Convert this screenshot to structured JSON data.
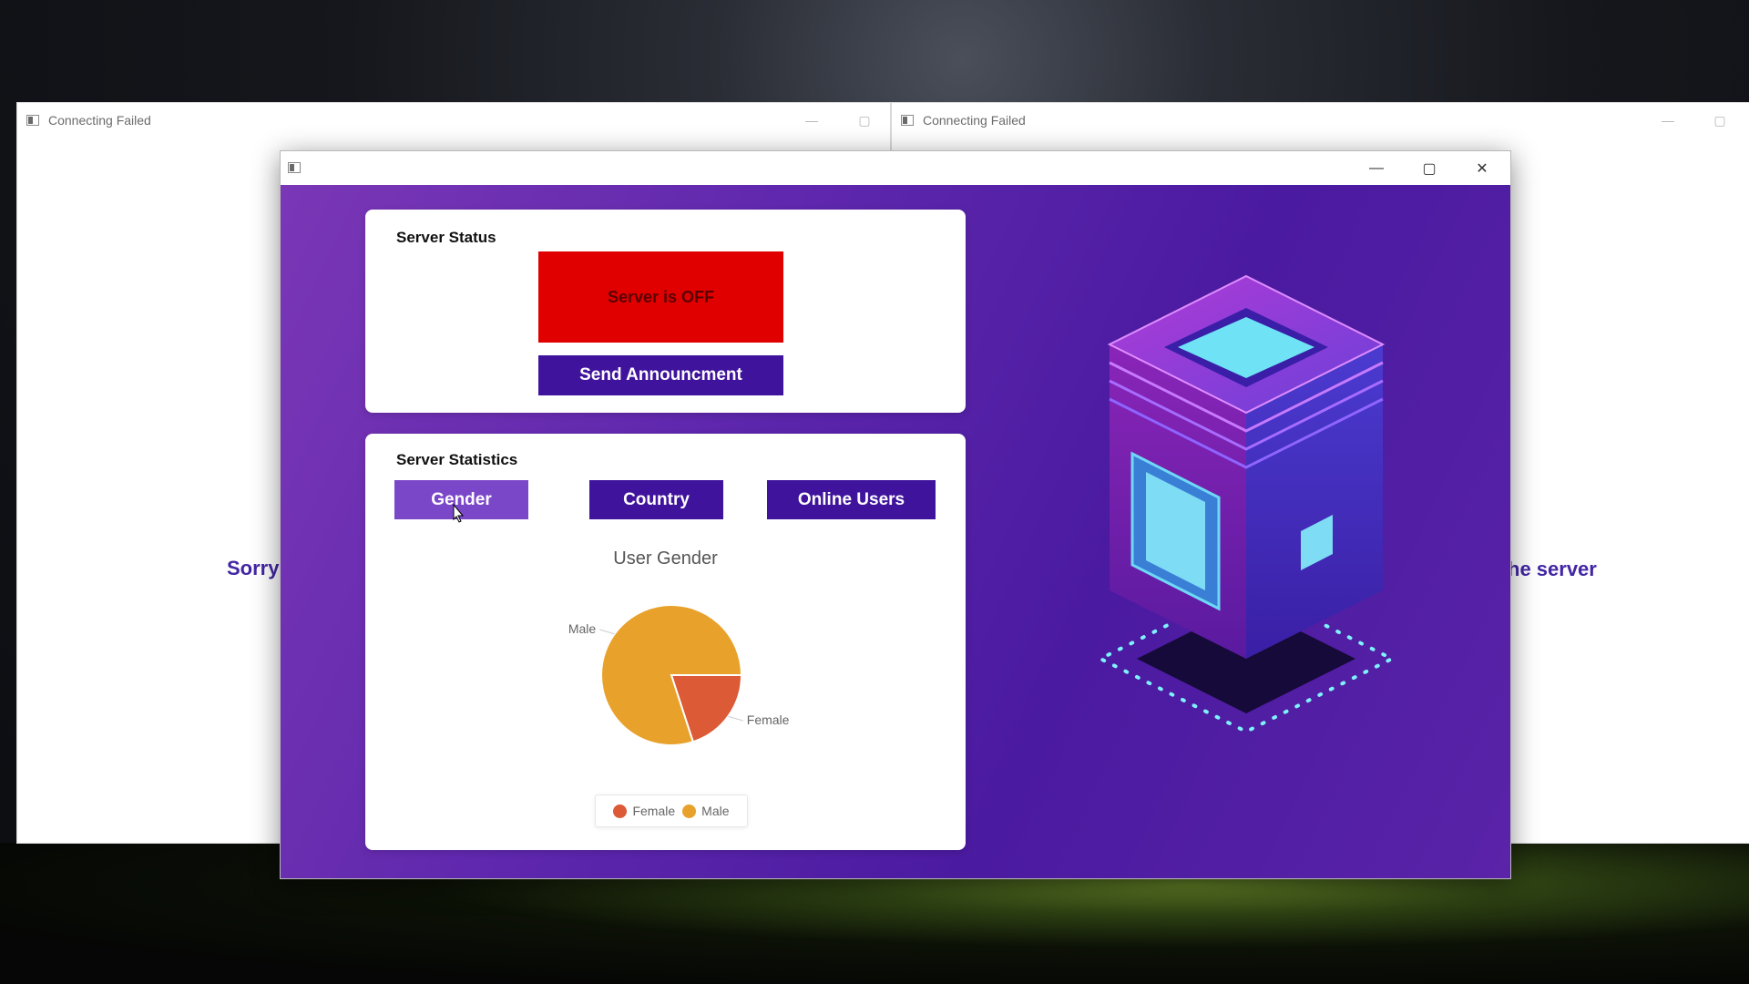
{
  "background_windows": [
    {
      "title": "Connecting Failed",
      "message_fragment": "Sorry"
    },
    {
      "title": "Connecting Failed",
      "message_fragment": "he server"
    }
  ],
  "main_window": {
    "title": "",
    "controls": {
      "minimize": "—",
      "maximize": "▢",
      "close": "✕"
    }
  },
  "server_status": {
    "title": "Server Status",
    "status_text": "Server is OFF",
    "status_color": "#e00000",
    "announce_button": "Send Announcment"
  },
  "server_statistics": {
    "title": "Server Statistics",
    "tabs": [
      {
        "label": "Gender",
        "active": true
      },
      {
        "label": "Country",
        "active": false
      },
      {
        "label": "Online Users",
        "active": false
      }
    ]
  },
  "chart_data": {
    "type": "pie",
    "title": "User Gender",
    "slices": [
      {
        "label": "Female",
        "value": 20,
        "color": "#dc5a35"
      },
      {
        "label": "Male",
        "value": 80,
        "color": "#e8a22c"
      }
    ],
    "legend": [
      "Female",
      "Male"
    ],
    "legend_placement": "bottom"
  },
  "colors": {
    "accent": "#3f139c",
    "accent_active": "#7b47c9",
    "male": "#e8a22c",
    "female": "#dc5a35"
  }
}
